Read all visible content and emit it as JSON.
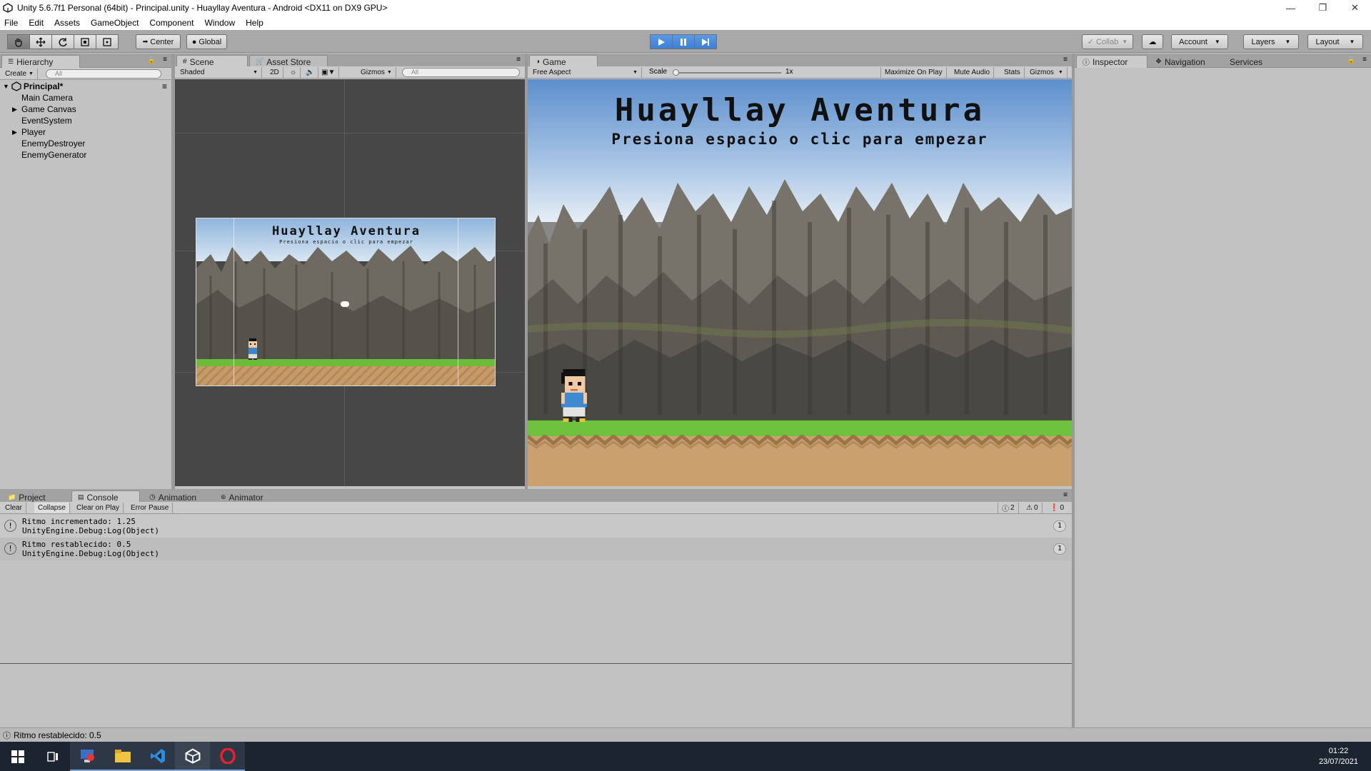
{
  "window": {
    "title": "Unity 5.6.7f1 Personal (64bit) - Principal.unity - Huayllay Aventura - Android <DX11 on DX9 GPU>"
  },
  "menu": [
    "File",
    "Edit",
    "Assets",
    "GameObject",
    "Component",
    "Window",
    "Help"
  ],
  "toolbar": {
    "pivot": "Center",
    "space": "Global",
    "collab": "Collab",
    "account": "Account",
    "layers": "Layers",
    "layout": "Layout"
  },
  "hierarchy": {
    "tab": "Hierarchy",
    "create": "Create",
    "search_placeholder": "All",
    "scene": "Principal*",
    "items": [
      "Main Camera",
      "Game Canvas",
      "EventSystem",
      "Player",
      "EnemyDestroyer",
      "EnemyGenerator"
    ]
  },
  "scene": {
    "tab": "Scene",
    "asset_store": "Asset Store",
    "shading": "Shaded",
    "mode_2d": "2D",
    "gizmos": "Gizmos",
    "search_placeholder": "All"
  },
  "game": {
    "tab": "Game",
    "aspect": "Free Aspect",
    "scale_label": "Scale",
    "scale_value": "1x",
    "maximize": "Maximize On Play",
    "mute": "Mute Audio",
    "stats": "Stats",
    "gizmos": "Gizmos",
    "title": "Huayllay Aventura",
    "subtitle": "Presiona espacio o clic para empezar"
  },
  "bottom_tabs": {
    "project": "Project",
    "console": "Console",
    "animation": "Animation",
    "animator": "Animator"
  },
  "console": {
    "clear": "Clear",
    "collapse": "Collapse",
    "clear_on_play": "Clear on Play",
    "error_pause": "Error Pause",
    "count_log": "2",
    "count_warn": "0",
    "count_error": "0",
    "entries": [
      {
        "line1": "Ritmo incrementado: 1.25",
        "line2": "UnityEngine.Debug:Log(Object)",
        "count": "1"
      },
      {
        "line1": "Ritmo restablecido: 0.5",
        "line2": "UnityEngine.Debug:Log(Object)",
        "count": "1"
      }
    ]
  },
  "inspector": {
    "tab": "Inspector",
    "navigation": "Navigation",
    "services": "Services"
  },
  "status": {
    "message": "Ritmo restablecido: 0.5"
  },
  "taskbar": {
    "time": "01:22",
    "date": "23/07/2021"
  }
}
